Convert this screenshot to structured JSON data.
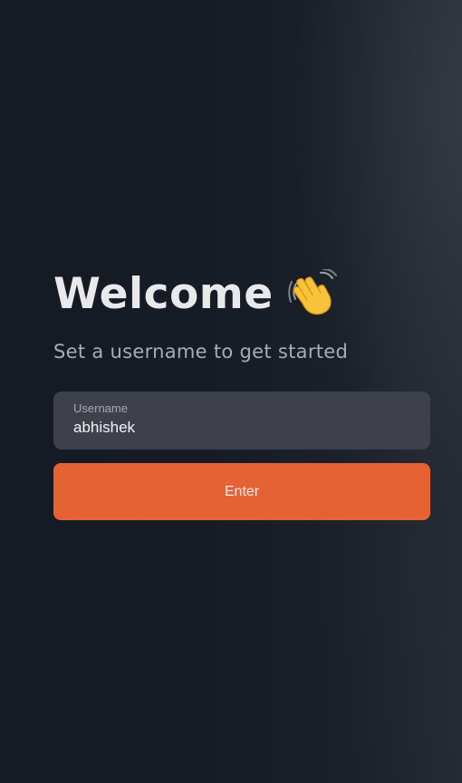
{
  "welcome": {
    "title": "Welcome",
    "subtitle": "Set a username to get started"
  },
  "form": {
    "username_label": "Username",
    "username_value": "abhishek",
    "enter_label": "Enter"
  },
  "icons": {
    "wave": "waving-hand-icon"
  },
  "colors": {
    "background": "#171b23",
    "field_background": "#3e414a",
    "accent": "#e66235",
    "title_text": "#e9e9ec",
    "subtitle_text": "#a9acb4"
  }
}
